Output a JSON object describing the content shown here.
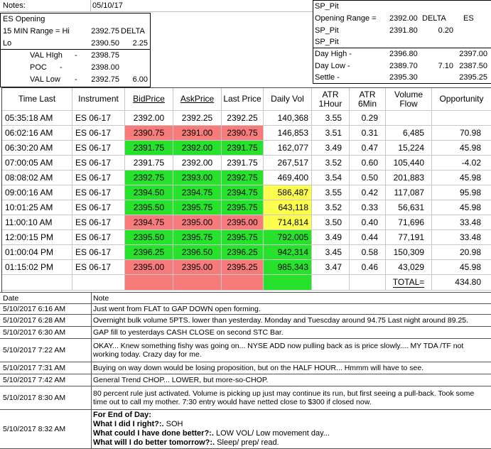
{
  "header": {
    "notes_label": "Notes:",
    "date": "05/10/17",
    "es_opening": {
      "title": "ES Opening",
      "range_label": "15 MIN Range = Hi",
      "hi_value": "2392.75",
      "delta_label": "DELTA",
      "lo_label": "Lo",
      "lo_value": "2390.50",
      "delta_value": "2.25",
      "val_high_label": "VAL HIgh",
      "val_high_value": "2398.75",
      "poc_label": "POC",
      "poc_value": "2398.00",
      "val_low_label": "VAL Low",
      "val_low_value": "2392.75",
      "val_low_extra": "6.00",
      "dash": "-"
    },
    "sp_pit": {
      "title1": "SP_Pit",
      "opening_range_label": "Opening Range =",
      "opening_range_value": "2392.00",
      "delta_label": "DELTA",
      "es_label": "ES",
      "opening_range_value2": "2391.80",
      "delta_value": "0.20",
      "title2": "SP_Pit",
      "title3": "SP_Pit",
      "day_high_label": "Day High -",
      "day_high_value": "2396.80",
      "day_high_es": "2397.00",
      "day_low_label": "Day Low -",
      "day_low_value": "2389.70",
      "day_low_delta": "7.10",
      "day_low_es": "2387.50",
      "settle_label": "Settle -",
      "settle_value": "2395.30",
      "settle_es": "2395.25"
    }
  },
  "table": {
    "columns": [
      "Time Last",
      "Instrument",
      "BidPrice",
      "AskPrice",
      "Last Price",
      "Daily Vol",
      "ATR 1Hour",
      "ATR 6Min",
      "Volume Flow",
      "Opportunity"
    ],
    "rows": [
      {
        "time": "05:35:18 AM",
        "inst": "ES 06-17",
        "bid": "2392.00",
        "ask": "2392.25",
        "last": "2392.25",
        "vol": "140,368",
        "atr1": "3.55",
        "atr6": "0.29",
        "flow": "",
        "opp": "",
        "color": "",
        "volcolor": ""
      },
      {
        "time": "06:02:16 AM",
        "inst": "ES 06-17",
        "bid": "2390.75",
        "ask": "2391.00",
        "last": "2390.75",
        "vol": "146,853",
        "atr1": "3.51",
        "atr6": "0.31",
        "flow": "6,485",
        "opp": "70.98",
        "color": "red",
        "volcolor": ""
      },
      {
        "time": "06:30:20 AM",
        "inst": "ES 06-17",
        "bid": "2391.75",
        "ask": "2392.00",
        "last": "2391.75",
        "vol": "162,077",
        "atr1": "3.49",
        "atr6": "0.47",
        "flow": "15,224",
        "opp": "45.98",
        "color": "green",
        "volcolor": ""
      },
      {
        "time": "07:00:05 AM",
        "inst": "ES 06-17",
        "bid": "2391.75",
        "ask": "2392.00",
        "last": "2391.75",
        "vol": "267,517",
        "atr1": "3.52",
        "atr6": "0.60",
        "flow": "105,440",
        "opp": "-4.02",
        "color": "",
        "volcolor": ""
      },
      {
        "time": "08:08:02 AM",
        "inst": "ES 06-17",
        "bid": "2392.75",
        "ask": "2393.00",
        "last": "2392.75",
        "vol": "469,400",
        "atr1": "3.54",
        "atr6": "0.50",
        "flow": "201,883",
        "opp": "45.98",
        "color": "green",
        "volcolor": ""
      },
      {
        "time": "09:00:16 AM",
        "inst": "ES 06-17",
        "bid": "2394.50",
        "ask": "2394.75",
        "last": "2394.75",
        "vol": "586,487",
        "atr1": "3.55",
        "atr6": "0.42",
        "flow": "117,087",
        "opp": "95.98",
        "color": "green",
        "volcolor": "yellow"
      },
      {
        "time": "10:01:25 AM",
        "inst": "ES 06-17",
        "bid": "2395.50",
        "ask": "2395.75",
        "last": "2395.75",
        "vol": "643,118",
        "atr1": "3.52",
        "atr6": "0.33",
        "flow": "56,631",
        "opp": "45.98",
        "color": "green",
        "volcolor": "yellow"
      },
      {
        "time": "11:00:10 AM",
        "inst": "ES 06-17",
        "bid": "2394.75",
        "ask": "2395.00",
        "last": "2395.00",
        "vol": "714,814",
        "atr1": "3.50",
        "atr6": "0.40",
        "flow": "71,696",
        "opp": "33.48",
        "color": "red",
        "volcolor": "yellow"
      },
      {
        "time": "12:00:15 PM",
        "inst": "ES 06-17",
        "bid": "2395.50",
        "ask": "2395.75",
        "last": "2395.75",
        "vol": "792,005",
        "atr1": "3.49",
        "atr6": "0.44",
        "flow": "77,191",
        "opp": "33.48",
        "color": "green",
        "volcolor": "green"
      },
      {
        "time": "01:00:04 PM",
        "inst": "ES 06-17",
        "bid": "2396.25",
        "ask": "2396.50",
        "last": "2396.25",
        "vol": "942,314",
        "atr1": "3.45",
        "atr6": "0.58",
        "flow": "150,309",
        "opp": "20.98",
        "color": "green",
        "volcolor": "green"
      },
      {
        "time": "01:15:02 PM",
        "inst": "ES 06-17",
        "bid": "2395.00",
        "ask": "2395.00",
        "last": "2395.25",
        "vol": "985,343",
        "atr1": "3.47",
        "atr6": "0.46",
        "flow": "43,029",
        "opp": "45.98",
        "color": "red",
        "volcolor": "green"
      }
    ],
    "total_label": "TOTAL=",
    "total_value": "434.80"
  },
  "notes": {
    "date_header": "Date",
    "note_header": "Note",
    "entries": [
      {
        "date": "5/10/2017 6:16 AM",
        "lines": [
          "Just went from FLAT to GAP DOWN open forming."
        ]
      },
      {
        "date": "5/10/2017 6:28 AM",
        "lines": [
          "Overnight bulk volume 5PTS. lower than yesterday.  Monday and Tuescday around 94.75 Last night around 89.25."
        ]
      },
      {
        "date": "5/10/2017 6:30 AM",
        "lines": [
          "GAP fill to yesterdays CASH CLOSE on second STC Bar."
        ]
      },
      {
        "date": "5/10/2017 7:22 AM",
        "lines": [
          "OKAY... Knew something fishy was going on... NYSE ADD now pulling back as is price slowly.... MY TDA /TF not",
          "working today.  Crazy day for me."
        ]
      },
      {
        "date": "5/10/2017 7:31 AM",
        "lines": [
          "Buying on way down would be losing proposition, but on the HALF HOUR... Hmmm will have to see."
        ]
      },
      {
        "date": "5/10/2017 7:42 AM",
        "lines": [
          "General Trend CHOP... LOWER, but more-so-CHOP."
        ]
      },
      {
        "date": "5/10/2017 8:30 AM",
        "lines": [
          "80 percent rule just activated.  Volume is picking up just may continue its run, but first seeing a pull-back.  Took some",
          "time out to call my mother.  7:30 entry would have netted close to $300 if closed now."
        ]
      },
      {
        "date": "5/10/2017 8:32 AM",
        "lines": [
          "For End of Day:",
          "What I did I right?:.  SOH",
          "What could I have done better?:.  LOW VOL/ Low movement day...",
          "What will I do better tomorrow?:.  Sleep/ prep/ read."
        ]
      }
    ]
  }
}
